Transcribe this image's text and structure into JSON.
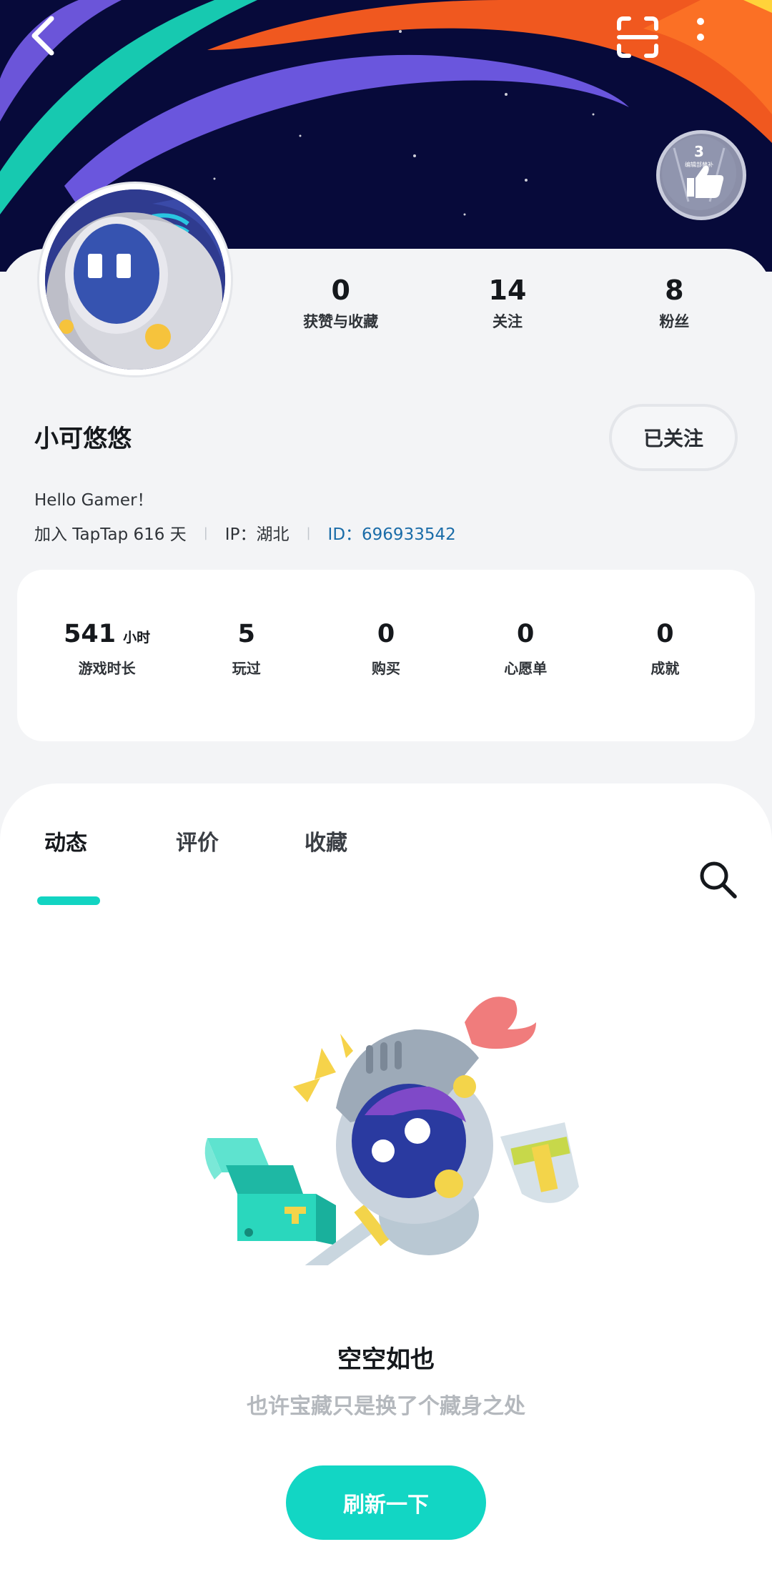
{
  "header": {
    "back_icon": "chevron-left-icon",
    "scan_icon": "scan-icon",
    "more_icon": "more-vertical-icon",
    "badge": {
      "level": "3",
      "caption": "编辑部替补",
      "icon": "thumbs-up-icon"
    }
  },
  "profile": {
    "username": "小可悠悠",
    "follow_label": "已关注",
    "bio": "Hello Gamer！",
    "joined": "加入 TapTap 616 天",
    "ip_label": "IP：湖北",
    "id_label": "ID：",
    "id_value": "696933542",
    "stats": [
      {
        "value": "0",
        "label": "获赞与收藏"
      },
      {
        "value": "14",
        "label": "关注"
      },
      {
        "value": "8",
        "label": "粉丝"
      }
    ]
  },
  "game_stats": [
    {
      "value": "541",
      "unit": "小时",
      "label": "游戏时长"
    },
    {
      "value": "5",
      "label": "玩过"
    },
    {
      "value": "0",
      "label": "购买"
    },
    {
      "value": "0",
      "label": "心愿单"
    },
    {
      "value": "0",
      "label": "成就"
    }
  ],
  "tabs": [
    {
      "label": "动态",
      "active": true
    },
    {
      "label": "评价",
      "active": false
    },
    {
      "label": "收藏",
      "active": false
    }
  ],
  "search_icon": "search-icon",
  "empty_state": {
    "title": "空空如也",
    "subtitle": "也许宝藏只是换了个藏身之处",
    "button_label": "刷新一下"
  },
  "colors": {
    "accent": "#12d6c4",
    "banner_bg": "#070a3a",
    "link": "#1a6ca8"
  }
}
